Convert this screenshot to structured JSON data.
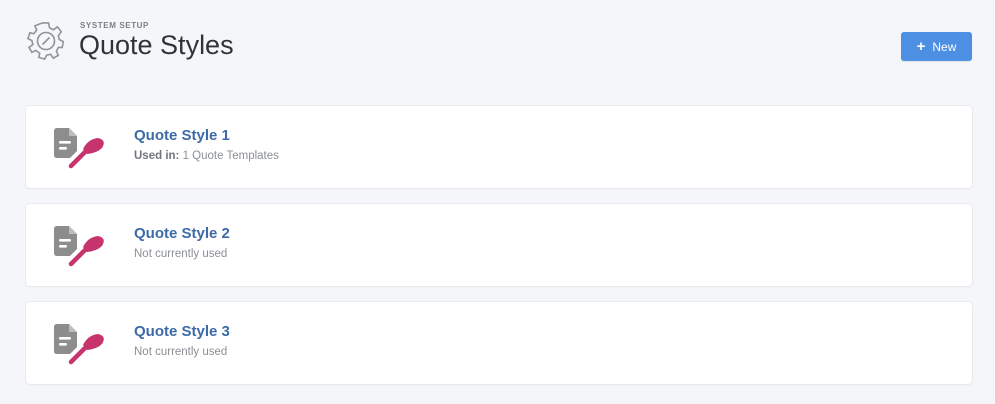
{
  "header": {
    "eyebrow": "SYSTEM SETUP",
    "title": "Quote Styles",
    "new_button_label": "New",
    "icon": "gear-icon"
  },
  "styles": [
    {
      "name": "Quote Style 1",
      "usage_label": "Used in:",
      "usage_value": "1 Quote Templates",
      "icon": "document-brush-icon"
    },
    {
      "name": "Quote Style 2",
      "usage_label": "",
      "usage_value": "Not currently used",
      "icon": "document-brush-icon"
    },
    {
      "name": "Quote Style 3",
      "usage_label": "",
      "usage_value": "Not currently used",
      "icon": "document-brush-icon"
    }
  ],
  "colors": {
    "accent": "#4d8fe3",
    "link": "#3d6aa8",
    "brush": "#c7336d",
    "doc": "#8d8d8d"
  }
}
